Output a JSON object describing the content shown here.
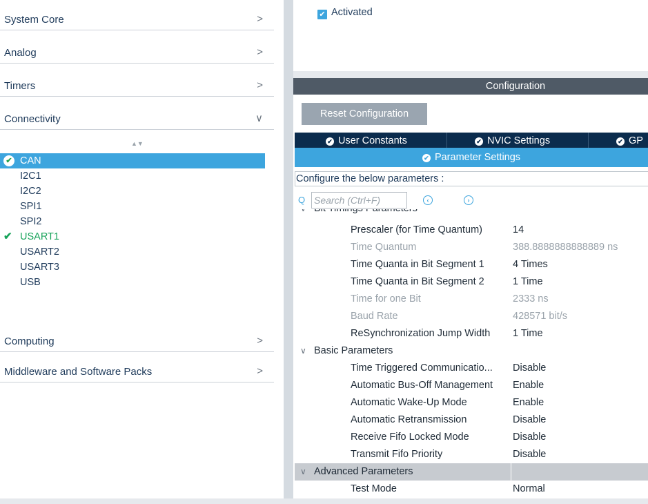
{
  "left": {
    "categories": [
      {
        "label": "System Core",
        "chevron": ">"
      },
      {
        "label": "Analog",
        "chevron": ">"
      },
      {
        "label": "Timers",
        "chevron": ">"
      },
      {
        "label": "Connectivity",
        "chevron": "∨"
      },
      {
        "label": "Computing",
        "chevron": ">"
      },
      {
        "label": "Middleware and Software Packs",
        "chevron": ">"
      }
    ],
    "sort_glyph": "▲▼",
    "peripherals": [
      {
        "label": "CAN",
        "state": "selected"
      },
      {
        "label": "I2C1",
        "state": ""
      },
      {
        "label": "I2C2",
        "state": ""
      },
      {
        "label": "SPI1",
        "state": ""
      },
      {
        "label": "SPI2",
        "state": ""
      },
      {
        "label": "USART1",
        "state": "enabled"
      },
      {
        "label": "USART2",
        "state": ""
      },
      {
        "label": "USART3",
        "state": ""
      },
      {
        "label": "USB",
        "state": ""
      }
    ],
    "check_glyph": "✔"
  },
  "mode": {
    "activated_label": "Activated",
    "activated_checked": true,
    "check_glyph": "✔"
  },
  "config": {
    "header": "Configuration",
    "reset_label": "Reset Configuration",
    "tabs": [
      {
        "label": "User Constants"
      },
      {
        "label": "NVIC Settings"
      },
      {
        "label": "GP"
      }
    ],
    "active_tab": "Parameter Settings",
    "tab_icon_glyph": "✔",
    "configure_text": "Configure the below parameters :",
    "search_placeholder": "Search (Ctrl+F)",
    "search_icon_glyph": "Q",
    "prev_glyph": "‹",
    "next_glyph": "›",
    "groups": {
      "bit_timings": {
        "label": "Bit Timings Parameters",
        "chevron": "∨"
      },
      "basic": {
        "label": "Basic Parameters",
        "chevron": "∨"
      },
      "advanced": {
        "label": "Advanced Parameters",
        "chevron": "∨"
      }
    },
    "bit_timing_params": [
      {
        "name": "Prescaler (for Time Quantum)",
        "value": "14",
        "dim": false
      },
      {
        "name": "Time Quantum",
        "value": "388.8888888888889 ns",
        "dim": true
      },
      {
        "name": "Time Quanta in Bit Segment 1",
        "value": "4 Times",
        "dim": false
      },
      {
        "name": "Time Quanta in Bit Segment 2",
        "value": "1 Time",
        "dim": false
      },
      {
        "name": "Time for one Bit",
        "value": "2333 ns",
        "dim": true
      },
      {
        "name": "Baud Rate",
        "value": "428571 bit/s",
        "dim": true
      },
      {
        "name": "ReSynchronization Jump Width",
        "value": "1 Time",
        "dim": false
      }
    ],
    "basic_params": [
      {
        "name": "Time Triggered Communicatio...",
        "value": "Disable",
        "dim": false
      },
      {
        "name": "Automatic Bus-Off Management",
        "value": "Enable",
        "dim": false
      },
      {
        "name": "Automatic Wake-Up Mode",
        "value": "Enable",
        "dim": false
      },
      {
        "name": "Automatic Retransmission",
        "value": "Disable",
        "dim": false
      },
      {
        "name": "Receive Fifo Locked Mode",
        "value": "Disable",
        "dim": false
      },
      {
        "name": "Transmit Fifo Priority",
        "value": "Disable",
        "dim": false
      }
    ],
    "advanced_params": [
      {
        "name": "Test Mode",
        "value": "Normal",
        "dim": false
      }
    ]
  }
}
